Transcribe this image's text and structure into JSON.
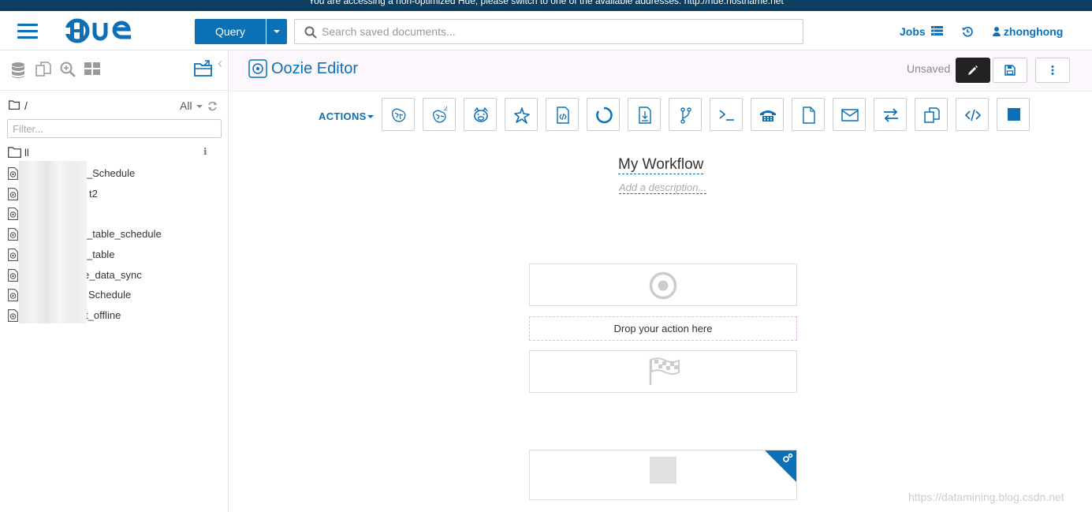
{
  "banner": {
    "text": "You are accessing a non-optimized Hue, please switch to one of the available addresses: http://hue.hostname.net"
  },
  "navbar": {
    "menu_icon": "hamburger-icon",
    "logo_text": "HUE",
    "query_label": "Query",
    "search_placeholder": "Search saved documents...",
    "jobs_label": "Jobs",
    "user_label": "zhonghong"
  },
  "left_panel": {
    "path_label": "/",
    "filter_label": "All",
    "filter_placeholder": "Filter...",
    "folder_name": "ll",
    "files": [
      "nt_Schedule",
      "t2",
      "",
      "_table_schedule",
      "_table",
      "e_data_sync",
      "Schedule",
      "t_offline"
    ]
  },
  "editor": {
    "title": "Oozie Editor",
    "status": "Unsaved",
    "actions_label": "ACTIONS",
    "workflow_name": "My Workflow",
    "workflow_description": "Add a description...",
    "drop_text": "Drop your action here",
    "tools": [
      "hive-icon",
      "hive2-icon",
      "pig-icon",
      "spark-icon",
      "java-icon",
      "sqoop-icon",
      "mapreduce-icon",
      "subworkflow-icon",
      "shell-icon",
      "ssh-icon",
      "fs-icon",
      "email-icon",
      "streaming-icon",
      "distcp-icon",
      "generic-icon",
      "kill-icon"
    ]
  },
  "colors": {
    "brand": "#0b70b5",
    "banner": "#0b3e61",
    "drop_border": "#e6b8e6"
  },
  "watermark": "https://datamining.blog.csdn.net"
}
